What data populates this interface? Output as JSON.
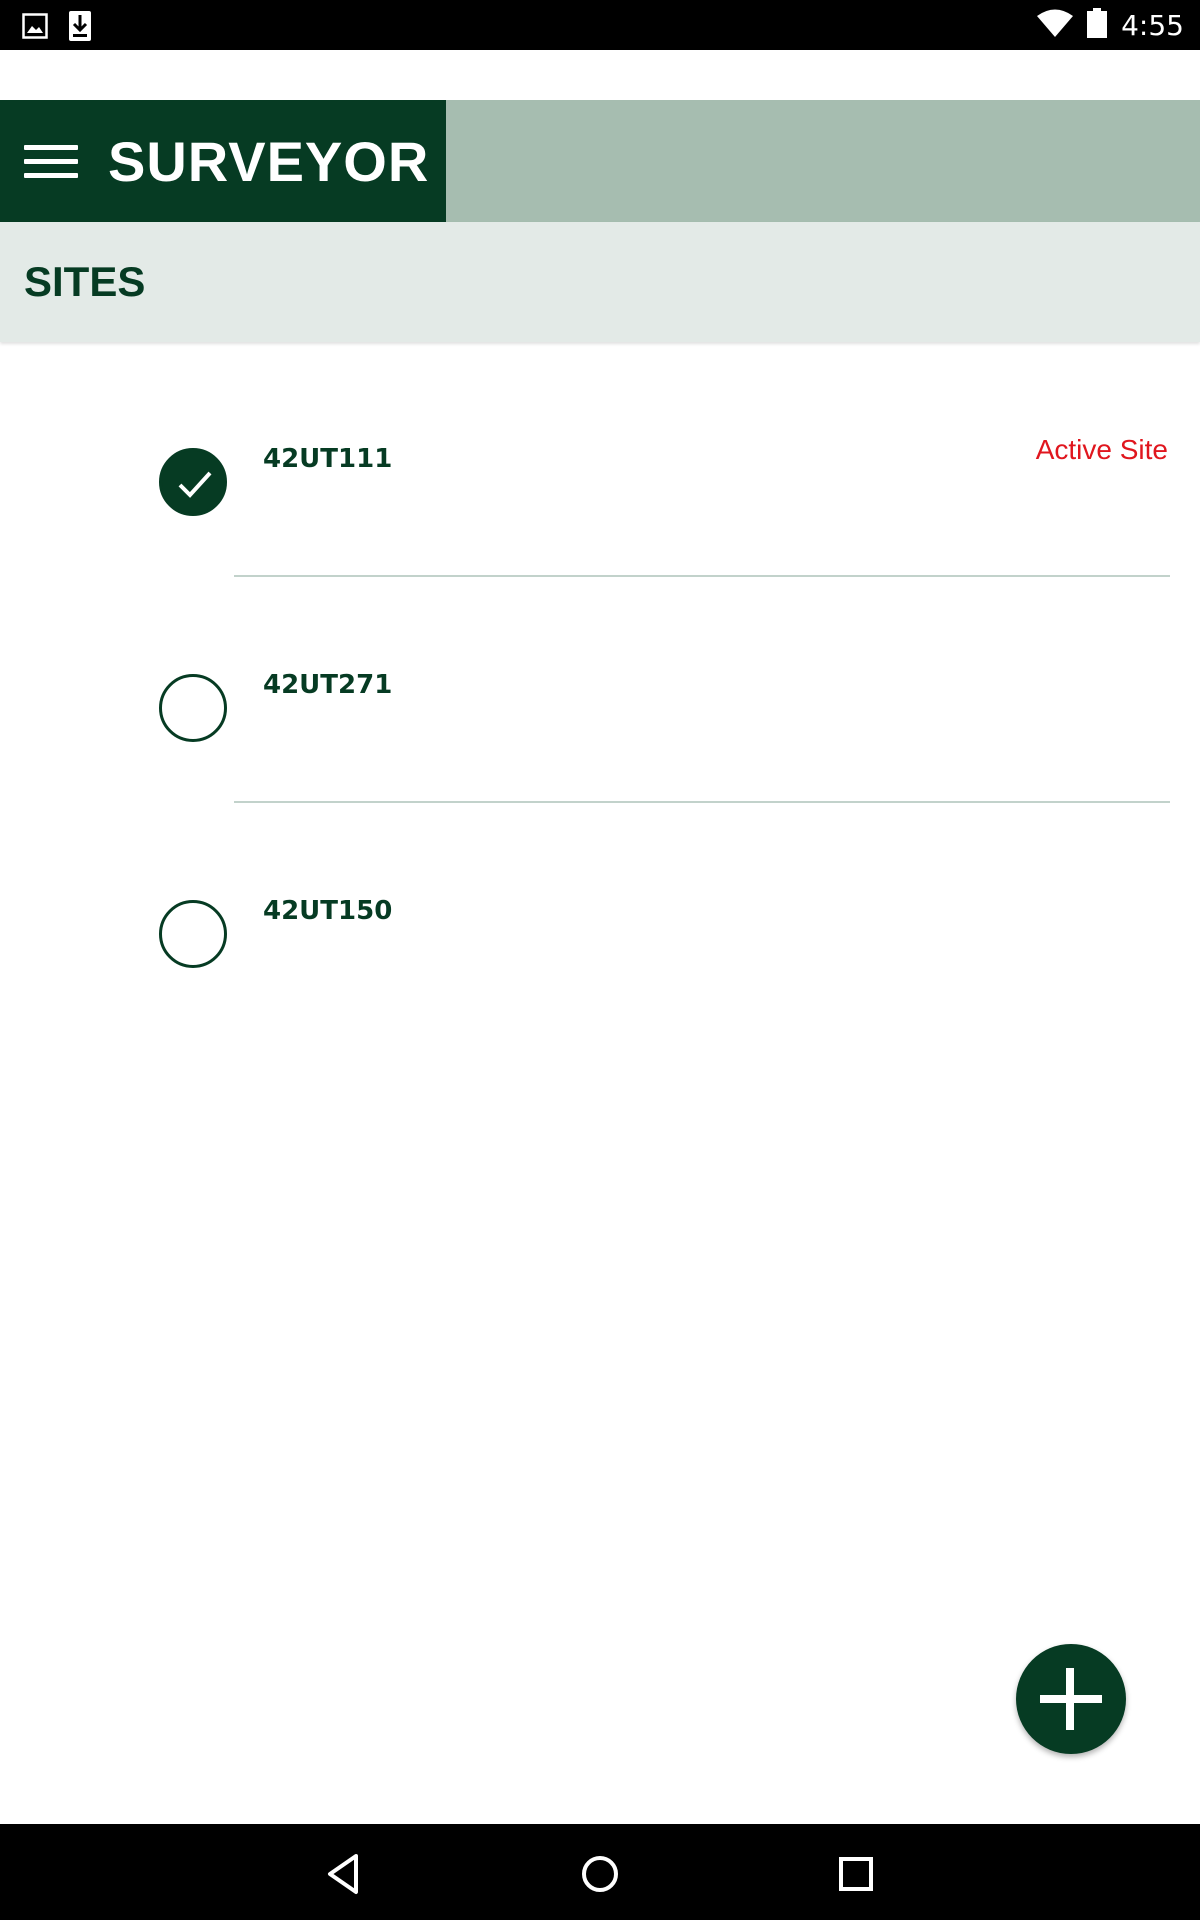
{
  "status_bar": {
    "time": "4:55",
    "icons": [
      "image-notification-icon",
      "download-notification-icon",
      "wifi-icon",
      "battery-icon"
    ]
  },
  "app_bar": {
    "title": "SURVEYOR",
    "menu_icon": "hamburger-menu-icon"
  },
  "section": {
    "title": "SITES"
  },
  "sites": [
    {
      "name": "42UT111",
      "checked": true,
      "badge": "Active Site"
    },
    {
      "name": "42UT271",
      "checked": false,
      "badge": ""
    },
    {
      "name": "42UT150",
      "checked": false,
      "badge": ""
    }
  ],
  "fab": {
    "icon": "plus-icon"
  },
  "nav_bar": {
    "icons": [
      "back-icon",
      "home-icon",
      "recents-icon"
    ]
  },
  "colors": {
    "primary_dark": "#063b23",
    "app_bar_light": "#a6bdb0",
    "section_bg": "#e3eae7",
    "active_text": "#e0161e"
  }
}
